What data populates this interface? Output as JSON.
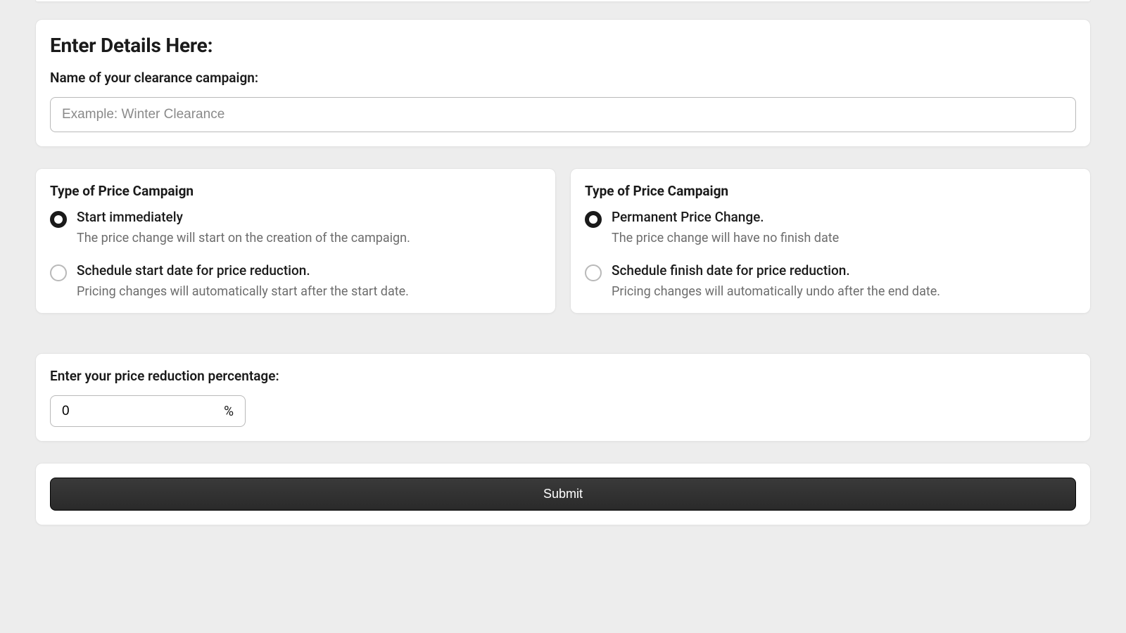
{
  "details": {
    "heading": "Enter Details Here:",
    "name_label": "Name of your clearance campaign:",
    "name_placeholder": "Example: Winter Clearance",
    "name_value": ""
  },
  "start": {
    "title": "Type of Price Campaign",
    "options": [
      {
        "label": "Start immediately",
        "description": "The price change will start on the creation of the campaign.",
        "selected": true
      },
      {
        "label": "Schedule start date for price reduction.",
        "description": "Pricing changes will automatically start after the start date.",
        "selected": false
      }
    ]
  },
  "finish": {
    "title": "Type of Price Campaign",
    "options": [
      {
        "label": "Permanent Price Change.",
        "description": "The price change will have no finish date",
        "selected": true
      },
      {
        "label": "Schedule finish date for price reduction.",
        "description": "Pricing changes will automatically undo after the end date.",
        "selected": false
      }
    ]
  },
  "percentage": {
    "label": "Enter your price reduction percentage:",
    "value": "0",
    "suffix": "%"
  },
  "submit": {
    "label": "Submit"
  }
}
